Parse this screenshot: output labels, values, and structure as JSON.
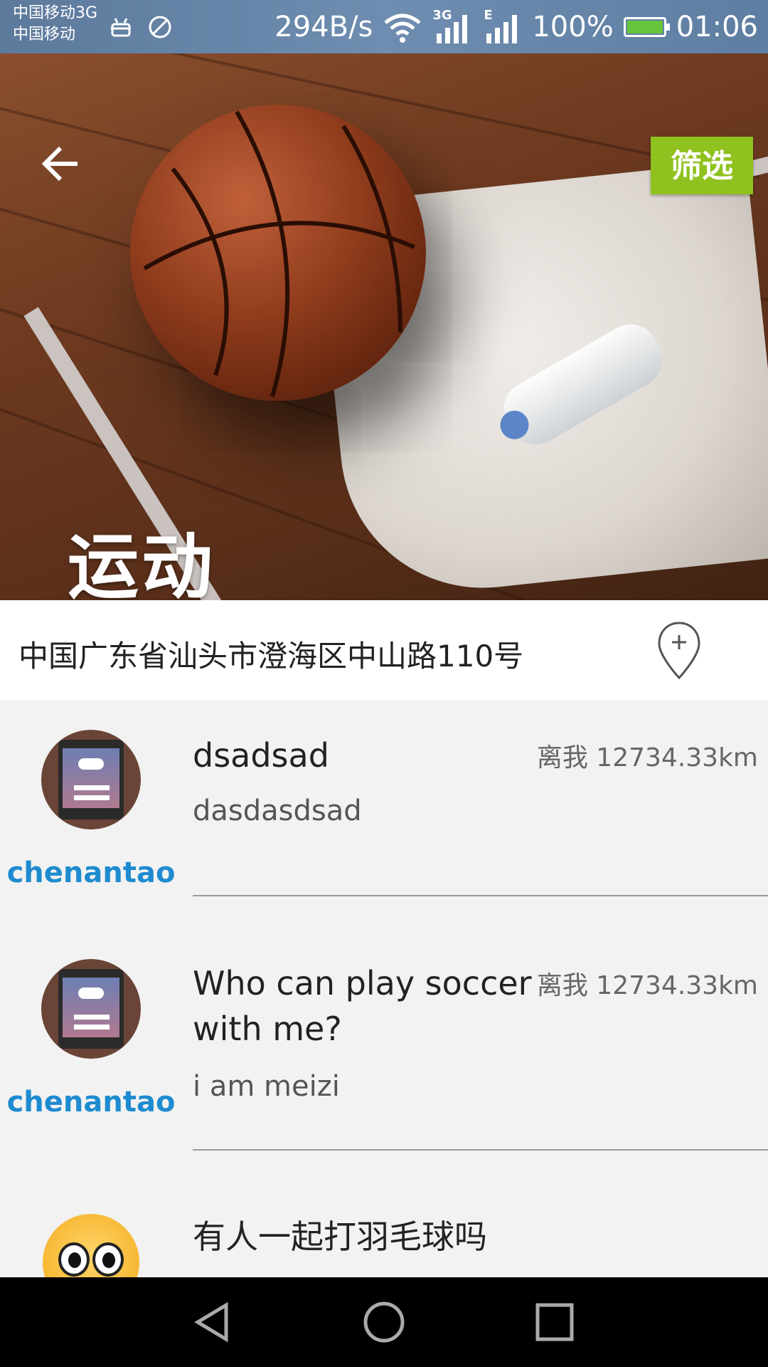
{
  "status_bar": {
    "carrier1": "中国移动3G",
    "carrier2": "中国移动",
    "speed": "294B/s",
    "net1": "3G",
    "net2": "E",
    "battery": "100%",
    "time": "01:06"
  },
  "header": {
    "filter_label": "筛选",
    "title": "运动"
  },
  "location": {
    "address": "中国广东省汕头市澄海区中山路110号"
  },
  "posts": [
    {
      "username": "chenantao",
      "title": "dsadsad",
      "content": "dasdasdsad",
      "distance": "离我 12734.33km"
    },
    {
      "username": "chenantao",
      "title": "Who can play soccer with me?",
      "content": "i am meizi",
      "distance": "离我 12734.33km"
    },
    {
      "title": "有人一起打羽毛球吗"
    }
  ],
  "colors": {
    "accent_green": "#8fc11f",
    "username_blue": "#1e8bd0"
  }
}
